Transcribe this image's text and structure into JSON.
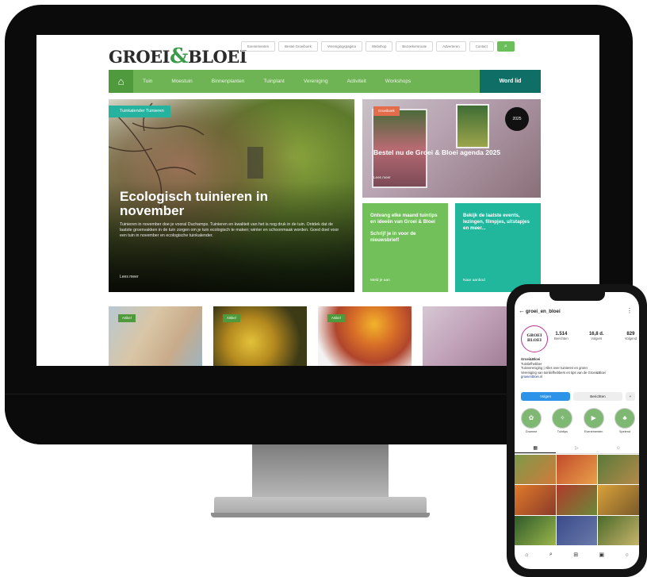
{
  "website": {
    "logo": {
      "left": "GROEI",
      "amp": "&",
      "right": "BLOEI"
    },
    "top_links": [
      "Evenementen",
      "Bestel Groeiboek",
      "Verenigingspagina",
      "Webshop",
      "Bezoekersroute",
      "Adverteren",
      "Contact"
    ],
    "nav": {
      "items": [
        "Tuin",
        "Moestuin",
        "Binnenplanten",
        "Tuinplant",
        "Vereniging",
        "Activiteit",
        "Workshops"
      ],
      "member_button": "Word lid"
    },
    "hero": {
      "tag": "Tuinkalender Tuinieren",
      "title": "Ecologisch tuinieren in november",
      "excerpt": "Tuinieren in november doe je vooral Duchamps. Tuinieren en kwaliteit van het is nog druk in de tuin. Ontdek dat de laatste groenvakken in de tuin zorgen om je tuin ecologisch te maken; winter en schoonmaak worden. Goed doel voor een tuin in november en ecologische tuinkalender.",
      "readmore": "Lees meer"
    },
    "card_wreath": {
      "label": "Groeiboek",
      "title": "Bestel nu de Groei & Bloei agenda 2025",
      "sub": "Lees meer",
      "badge": "2025"
    },
    "card_green": {
      "line1": "Ontvang elke maand tuintips en ideeën van Groei & Bloei",
      "line2": "Schrijf je in voor de nieuwsbrief!",
      "link": "Meld je aan"
    },
    "card_teal": {
      "line1": "Bekijk de laatste events, lezingen, filmpjes, uitstapjes en meer...",
      "link": "Naar aanbod"
    },
    "thumb_label": "Artikel"
  },
  "phone": {
    "username": "groei_en_bloei",
    "avatar": {
      "line1": "GROEI",
      "line2": "BLOEI"
    },
    "stats": [
      {
        "n": "1.514",
        "l": "Berichten"
      },
      {
        "n": "16,8 d.",
        "l": "Volgers"
      },
      {
        "n": "829",
        "l": "Volgend"
      }
    ],
    "bio": [
      "Groei&Bloei",
      "Tuinliefhebber",
      "Tuinvereniging | Alles over tuinieren en groen",
      "Vereniging van tuinliefhebbers en tips van de Groei&Bloei",
      "groeienbloei.nl"
    ],
    "follow": "Volgen",
    "message": "Berichten",
    "highlights": [
      "Groenne",
      "Tuintips",
      "Evenementen",
      "Spelend"
    ],
    "tabs": [
      "▦",
      "▷",
      "☺"
    ],
    "bottom": [
      "⌂",
      "⌕",
      "⊞",
      "▣",
      "○"
    ]
  }
}
